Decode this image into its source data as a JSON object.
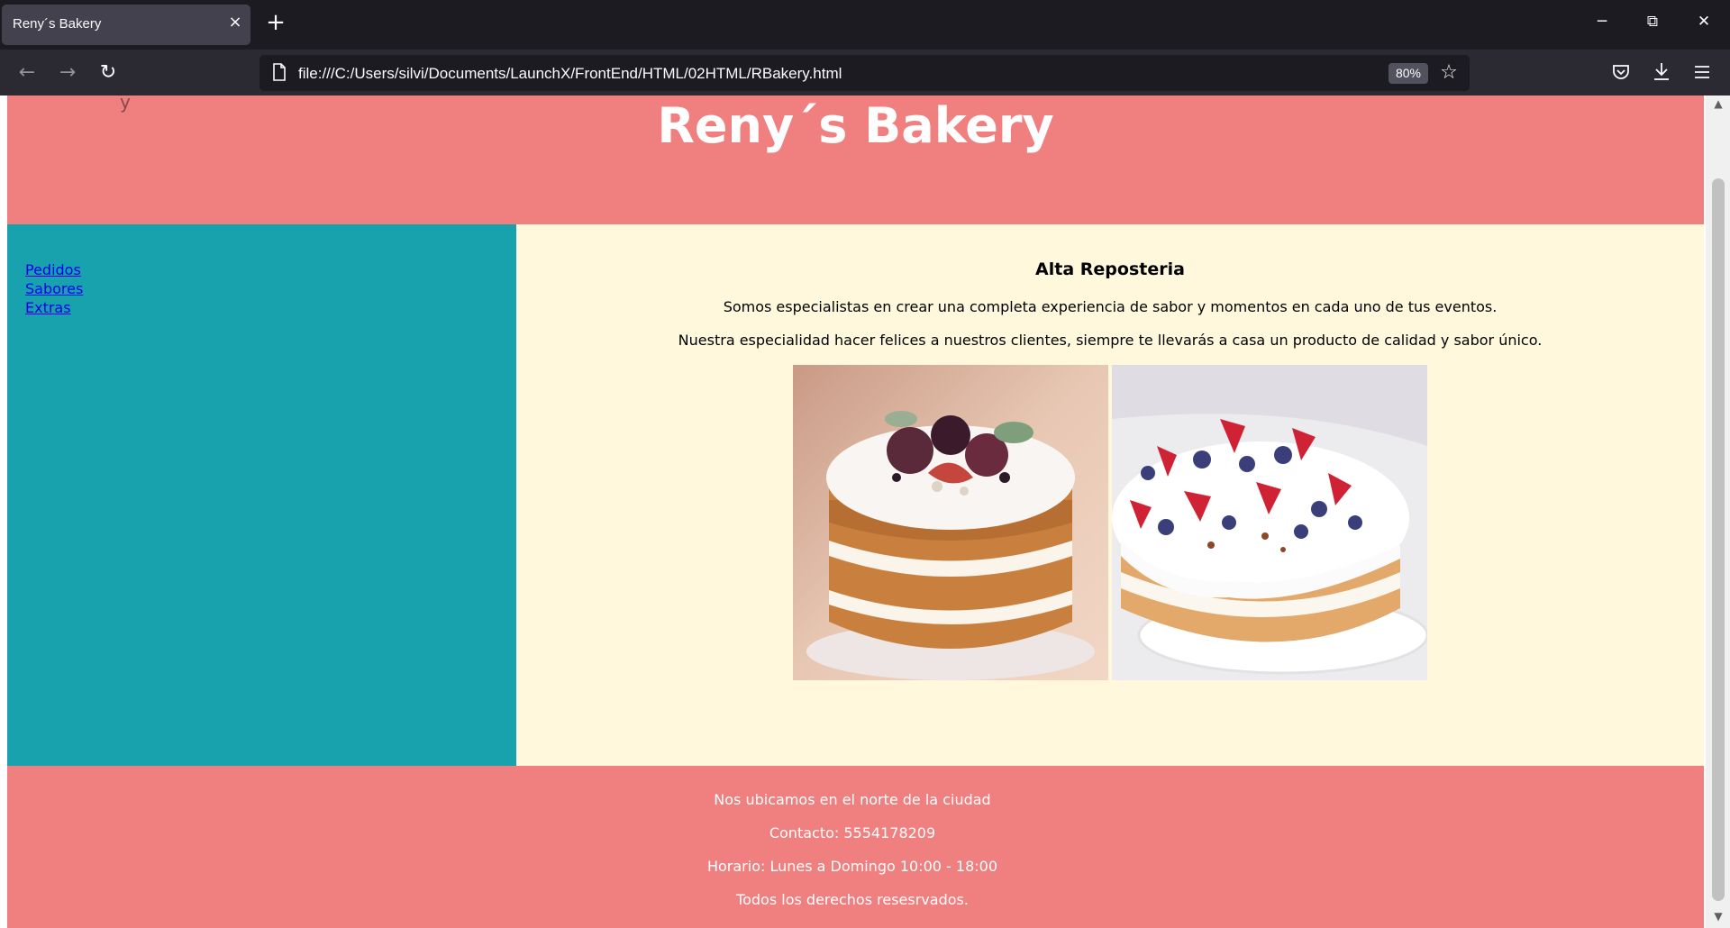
{
  "browser": {
    "tab_title": "Reny´s Bakery",
    "tab_close": "×",
    "new_tab": "+",
    "window_controls": {
      "minimize": "─",
      "restore": "⧉",
      "close": "✕"
    },
    "nav": {
      "back": "←",
      "forward": "→",
      "reload": "↻"
    },
    "url": "file:///C:/Users/silvi/Documents/LaunchX/FrontEnd/HTML/02HTML/RBakery.html",
    "zoom": "80%",
    "bookmark_icon": "star-icon",
    "toolbar_icons": [
      "pocket-icon",
      "download-icon",
      "menu-icon"
    ]
  },
  "page": {
    "header": {
      "title": "Reny´s Bakery",
      "partial_text": "y"
    },
    "sidebar": {
      "links": [
        "Pedidos",
        "Sabores",
        "Extras"
      ]
    },
    "main": {
      "heading": "Alta Reposteria",
      "paragraphs": [
        "Somos especialistas en crear una completa experiencia de sabor y momentos en cada uno de tus eventos.",
        "Nuestra especialidad hacer felices a nuestros clientes, siempre te llevarás a casa un producto de calidad y sabor único."
      ],
      "images": [
        "naked-cake-figs",
        "naked-cake-berries"
      ]
    },
    "footer": {
      "lines": [
        "Nos ubicamos en el norte de la ciudad",
        "Contacto: 5554178209",
        "Horario: Lunes a Domingo 10:00 - 18:00",
        "Todos los derechos resesrvados."
      ]
    }
  },
  "colors": {
    "header_bg": "#f07f7f",
    "sidebar_bg": "#17a2ae",
    "main_bg": "#fff8dc",
    "footer_bg": "#f07f7f",
    "link": "#0000ee"
  }
}
